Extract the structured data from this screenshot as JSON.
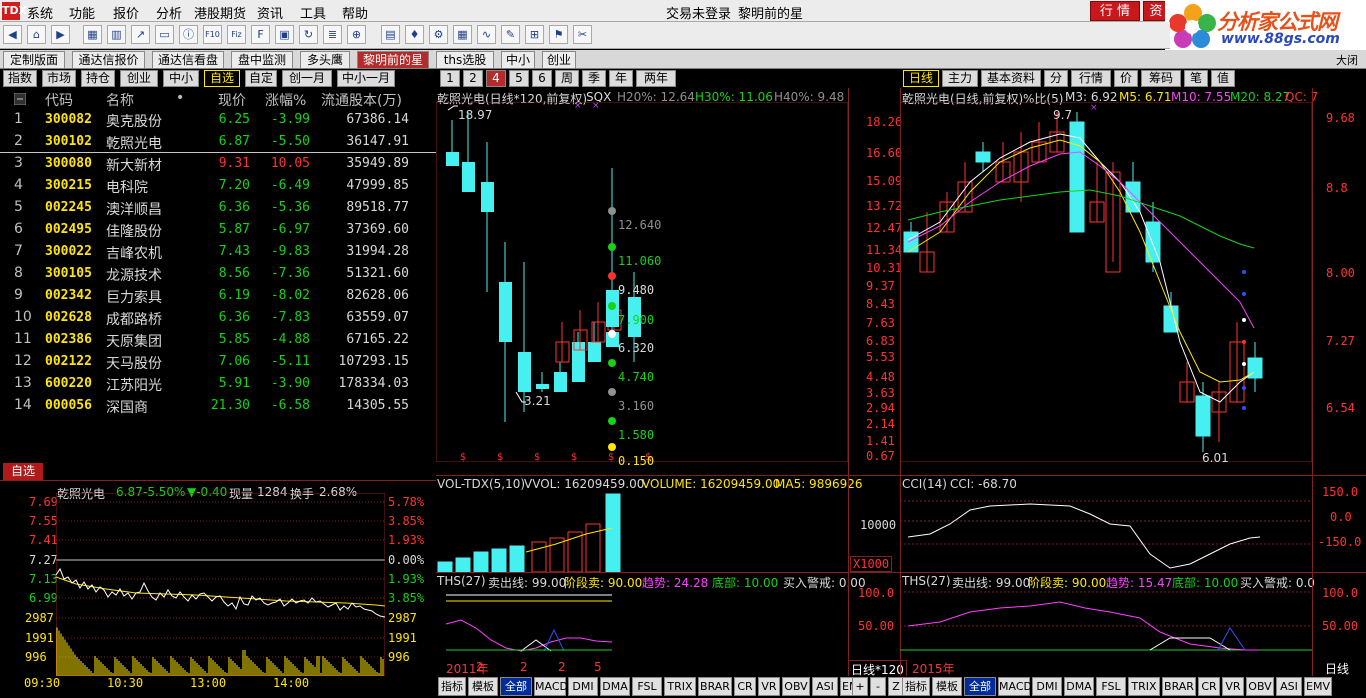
{
  "menu": {
    "logo": "TDX",
    "items": [
      "系统",
      "功能",
      "报价",
      "分析",
      "港股期货",
      "资讯",
      "工具",
      "帮助"
    ],
    "status": "交易未登录",
    "title": "黎明前的星",
    "btn_quote": "行 情",
    "btn_trade": "资"
  },
  "brand": {
    "name": "分析家公式网",
    "url": "www.88gs.com"
  },
  "toolbar": {
    "icons": [
      "back-icon",
      "home-icon",
      "forward-icon",
      "grid-icon",
      "kline-icon",
      "chart-icon",
      "window-icon",
      "info-icon",
      "f10-icon",
      "fiz-icon",
      "f10b-icon",
      "layout-icon",
      "rotate-icon",
      "report-icon",
      "zoom-icon",
      "bars-icon",
      "candle-icon",
      "gear-icon",
      "table-icon",
      "line-icon",
      "pen-icon",
      "multi-icon",
      "flag-icon",
      "tool-icon"
    ]
  },
  "view_tabs": [
    "定制版面",
    "通达信报价",
    "通达信看盘",
    "盘中监测",
    "多头鹰",
    "黎明前的星",
    "ths选股",
    "中小",
    "创业"
  ],
  "view_tab_active": 5,
  "close_label": "大闭",
  "left_tabs": [
    "指数",
    "市场",
    "持仓",
    "创业",
    "中小",
    "自选",
    "自定",
    "创一月",
    "中小一月"
  ],
  "left_tab_active": 5,
  "period_tabs": [
    "1",
    "2",
    "4",
    "5",
    "6",
    "周",
    "季",
    "年",
    "两年"
  ],
  "period_tab_active": 2,
  "right_tabs": [
    "日线",
    "主力",
    "基本资料",
    "分",
    "行情",
    "价",
    "筹码",
    "笔",
    "值"
  ],
  "right_tab_active": 0,
  "stock_list": {
    "headers": {
      "code": "代码",
      "name": "名称",
      "dot": "•",
      "price": "现价",
      "change": "涨幅%",
      "shares": "流通股本(万)"
    },
    "rows": [
      {
        "idx": "1",
        "code": "300082",
        "name": "奥克股份",
        "price": "6.25",
        "change": "-3.99",
        "shares": "67386.14",
        "color": "green"
      },
      {
        "idx": "2",
        "code": "300102",
        "name": "乾照光电",
        "price": "6.87",
        "change": "-5.50",
        "shares": "36147.91",
        "color": "green"
      },
      {
        "idx": "3",
        "code": "300080",
        "name": "新大新材",
        "price": "9.31",
        "change": "10.05",
        "shares": "35949.89",
        "color": "red"
      },
      {
        "idx": "4",
        "code": "300215",
        "name": "电科院",
        "price": "7.20",
        "change": "-6.49",
        "shares": "47999.85",
        "color": "green"
      },
      {
        "idx": "5",
        "code": "002245",
        "name": "澳洋顺昌",
        "price": "6.36",
        "change": "-5.36",
        "shares": "89518.77",
        "color": "green"
      },
      {
        "idx": "6",
        "code": "002495",
        "name": "佳隆股份",
        "price": "5.87",
        "change": "-6.97",
        "shares": "37369.60",
        "color": "green"
      },
      {
        "idx": "7",
        "code": "300022",
        "name": "吉峰农机",
        "price": "7.43",
        "change": "-9.83",
        "shares": "31994.28",
        "color": "green"
      },
      {
        "idx": "8",
        "code": "300105",
        "name": "龙源技术",
        "price": "8.56",
        "change": "-7.36",
        "shares": "51321.60",
        "color": "green"
      },
      {
        "idx": "9",
        "code": "002342",
        "name": "巨力索具",
        "price": "6.19",
        "change": "-8.02",
        "shares": "82628.06",
        "color": "green"
      },
      {
        "idx": "10",
        "code": "002628",
        "name": "成都路桥",
        "price": "6.36",
        "change": "-7.83",
        "shares": "63559.07",
        "color": "green"
      },
      {
        "idx": "11",
        "code": "002386",
        "name": "天原集团",
        "price": "5.85",
        "change": "-4.88",
        "shares": "67165.22",
        "color": "green"
      },
      {
        "idx": "12",
        "code": "002122",
        "name": "天马股份",
        "price": "7.06",
        "change": "-5.11",
        "shares": "107293.15",
        "color": "green"
      },
      {
        "idx": "13",
        "code": "600220",
        "name": "江苏阳光",
        "price": "5.91",
        "change": "-3.90",
        "shares": "178334.03",
        "color": "green"
      },
      {
        "idx": "14",
        "code": "000056",
        "name": "深国商",
        "price": "21.30",
        "change": "-6.58",
        "shares": "14305.55",
        "color": "green"
      }
    ]
  },
  "intraday": {
    "tag": "自选",
    "name": "乾照光电",
    "price": "6.87",
    "pct": "-5.50%",
    "chg": "▼-0.40",
    "vol_label": "现量",
    "vol": "1284",
    "turn_label": "换手",
    "turn": "2.68%",
    "left_axis": [
      "7.69",
      "7.55",
      "7.41",
      "7.27",
      "7.13",
      "6.99",
      "2987",
      "1991",
      "996"
    ],
    "right_axis": [
      "5.78%",
      "3.85%",
      "1.93%",
      "0.00%",
      "1.93%",
      "3.85%",
      "2987",
      "1991",
      "996"
    ],
    "times": [
      "09:30",
      "10:30",
      "13:00",
      "14:00"
    ]
  },
  "kline_left": {
    "title": "乾照光电(日线*120,前复权)",
    "sqx": "SQX",
    "h20": "H20%: 12.64",
    "h30": "H30%: 11.06",
    "h40": "H40%: 9.48",
    "high_label": "18.97",
    "low_label": "3.21",
    "levels": [
      "12.640",
      "11.060",
      "9.480",
      "7.900",
      "6.320",
      "4.740",
      "3.160",
      "1.580",
      "0.150"
    ],
    "right_axis": [
      "18.26",
      "16.60",
      "15.09",
      "13.72",
      "12.47",
      "11.34",
      "10.31",
      "9.37",
      "8.43",
      "7.63",
      "6.83",
      "5.53",
      "4.48",
      "3.63",
      "2.94",
      "2.14",
      "1.41",
      "0.67"
    ],
    "vol_title": "VOL-TDX(5,10)",
    "vvol": "VVOL: 16209459.00",
    "volume": "VOLUME: 16209459.00",
    "ma5": "MA5: 9896926",
    "vol_axis": [
      "10000"
    ],
    "vol_unit": "X1000",
    "ths_title": "THS(27)",
    "sell": "卖出线: 99.00",
    "stage": "阶段卖: 90.00",
    "trend": "趋势: 24.28",
    "bottom": "底部: 10.00",
    "buy": "买入警戒: 0.00",
    "ths_axis": [
      "100.0",
      "50.00"
    ],
    "date_axis": [
      "2011年",
      "2",
      "2",
      "2",
      "5"
    ],
    "period_label": "日线*120"
  },
  "kline_right": {
    "title": "乾照光电(日线,前复权)",
    "pctbi": "%比(5)",
    "m3": "M3: 6.92",
    "m5": "M5: 6.71",
    "m10": "M10: 7.55",
    "m20": "M20: 8.27",
    "qc": "QC: 7",
    "high_label": "9.7",
    "low_label": "6.01",
    "right_axis": [
      "9.68",
      "8.8",
      "8.00",
      "7.27",
      "6.54"
    ],
    "cci_title": "CCI(14)",
    "cci": "CCI: -68.70",
    "cci_axis": [
      "150.0",
      "0.0",
      "-150.0"
    ],
    "ths_title": "THS(27)",
    "sell": "卖出线: 99.00",
    "stage": "阶段卖: 90.00",
    "trend": "趋势: 15.47",
    "bottom": "底部: 10.00",
    "buy": "买入警戒: 0.0",
    "ths_axis": [
      "100.0",
      "50.00"
    ],
    "date_axis": [
      "2015年"
    ],
    "period_label": "日线"
  },
  "bottom_tabs": [
    "指标",
    "模板",
    "全部",
    "MACD",
    "DMI",
    "DMA",
    "FSL",
    "TRIX",
    "BRAR",
    "CR",
    "VR",
    "OBV",
    "ASI",
    "EMV",
    "+",
    "-",
    "Z"
  ],
  "bottom_tab_active": 2,
  "colors": {
    "up": "#ff3232",
    "down": "#46f0f0",
    "border": "#802020",
    "accent": "#ffe600"
  }
}
